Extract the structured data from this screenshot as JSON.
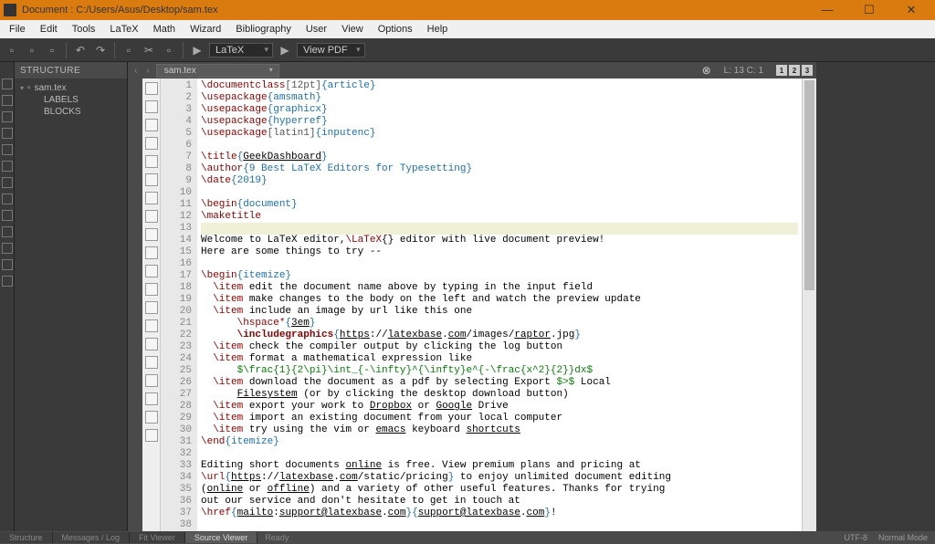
{
  "window": {
    "title": "Document : C:/Users/Asus/Desktop/sam.tex",
    "minimize": "—",
    "maximize": "☐",
    "close": "✕"
  },
  "menu": {
    "file": "File",
    "edit": "Edit",
    "tools": "Tools",
    "latex": "LaTeX",
    "math": "Math",
    "wizard": "Wizard",
    "bibliography": "Bibliography",
    "user": "User",
    "view": "View",
    "options": "Options",
    "help": "Help"
  },
  "toolbar": {
    "compiler": "LaTeX",
    "viewpdf": "View PDF"
  },
  "structure": {
    "title": "STRUCTURE",
    "root": "sam.tex",
    "labels": "LABELS",
    "blocks": "BLOCKS"
  },
  "tab": {
    "name": "sam.tex",
    "cursor": "L: 13 C: 1",
    "pages": [
      "1",
      "2",
      "3"
    ]
  },
  "lines": [
    "1",
    "2",
    "3",
    "4",
    "5",
    "6",
    "7",
    "8",
    "9",
    "10",
    "11",
    "12",
    "13",
    "14",
    "15",
    "16",
    "17",
    "18",
    "19",
    "20",
    "21",
    "22",
    "23",
    "24",
    "25",
    "26",
    "27",
    "28",
    "29",
    "30",
    "31",
    "32",
    "33",
    "34",
    "35",
    "36",
    "37",
    "38"
  ],
  "code": {
    "c1_cmd": "\\documentclass",
    "c1_opt": "[12pt]",
    "c1_arg": "{article}",
    "c2_cmd": "\\usepackage",
    "c2_arg": "{amsmath}",
    "c3_cmd": "\\usepackage",
    "c3_arg": "{graphicx}",
    "c4_cmd": "\\usepackage",
    "c4_arg": "{hyperref}",
    "c5_cmd": "\\usepackage",
    "c5_opt": "[latin1]",
    "c5_arg": "{inputenc}",
    "c7_cmd": "\\title",
    "c7_open": "{",
    "c7_txt": "GeekDashboard",
    "c7_close": "}",
    "c8_cmd": "\\author",
    "c8_arg": "{9 Best LaTeX Editors for Typesetting}",
    "c9_cmd": "\\date",
    "c9_arg": "{2019}",
    "c11_cmd": "\\begin",
    "c11_arg": "{document}",
    "c12_cmd": "\\maketitle",
    "c14_a": "Welcome to LaTeX editor,",
    "c14_cmd": "\\LaTeX",
    "c14_b": "{} editor with live document preview!",
    "c15": "Here are some things to try --",
    "c17_cmd": "\\begin",
    "c17_arg": "{itemize}",
    "c18_cmd": "\\item",
    "c18_txt": " edit the document name above by typing in the input field",
    "c19_cmd": "\\item",
    "c19_txt": " make changes to the body on the left and watch the preview update",
    "c20_cmd": "\\item",
    "c20_txt": " include an image by url like this one",
    "c21_cmd": "\\hspace*",
    "c21_open": "{",
    "c21_txt": "3em",
    "c21_close": "}",
    "c22_cmd": "\\includegraphics",
    "c22_open": "{",
    "c22_a": "https",
    "c22_b": "://",
    "c22_c": "latexbase",
    "c22_d": ".",
    "c22_e": "com",
    "c22_f": "/images/",
    "c22_g": "raptor",
    "c22_h": ".jpg",
    "c22_close": "}",
    "c23_cmd": "\\item",
    "c23_txt": " check the compiler output by clicking the log button",
    "c24_cmd": "\\item",
    "c24_txt": " format a mathematical expression like",
    "c25_math": "$\\frac{1}{2\\pi}\\int_{-\\infty}^{\\infty}e^{-\\frac{x^2}{2}}dx$",
    "c26_cmd": "\\item",
    "c26_a": " download the document as a pdf by selecting Export ",
    "c26_m": "$>$",
    "c26_b": " Local",
    "c27_ul": "Filesystem",
    "c27_txt": " (or by clicking the desktop download button)",
    "c28_cmd": "\\item",
    "c28_a": " export your work to ",
    "c28_d": "Dropbox",
    "c28_b": " or ",
    "c28_g": "Google",
    "c28_c": " Drive",
    "c29_cmd": "\\item",
    "c29_txt": " import an existing document from your local computer",
    "c30_cmd": "\\item",
    "c30_a": " try using the vim or ",
    "c30_e": "emacs",
    "c30_b": " keyboard ",
    "c30_s": "shortcuts",
    "c31_cmd": "\\end",
    "c31_arg": "{itemize}",
    "c33_a": "Editing short documents ",
    "c33_o": "online",
    "c33_b": " is free. View premium plans and pricing at",
    "c34_cmd": "\\url",
    "c34_open": "{",
    "c34_a": "https",
    "c34_b": "://",
    "c34_c": "latexbase",
    "c34_d": ".",
    "c34_e": "com",
    "c34_f": "/static/pricing",
    "c34_close": "}",
    "c34_txt": " to enjoy unlimited document editing",
    "c35_a": "(",
    "c35_on": "online",
    "c35_b": " or ",
    "c35_off": "offline",
    "c35_c": ") and a variety of other useful features. Thanks for trying",
    "c36": "out our service and don't hesitate to get in touch at",
    "c37_cmd": "\\href",
    "c37_o1": "{",
    "c37_m": "mailto",
    "c37_col": ":",
    "c37_e1": "support@latexbase",
    "c37_d1": ".",
    "c37_com1": "com",
    "c37_c1": "}",
    "c37_o2": "{",
    "c37_e2": "support@latexbase",
    "c37_d2": ".",
    "c37_com2": "com",
    "c37_c2": "}",
    "c37_ex": "!"
  },
  "bottom": {
    "structure": "Structure",
    "messages": "Messages / Log",
    "fitviewer": "Fit Viewer",
    "source": "Source Viewer",
    "ready": "Ready",
    "encoding": "UTF-8",
    "mode": "Normal Mode"
  }
}
